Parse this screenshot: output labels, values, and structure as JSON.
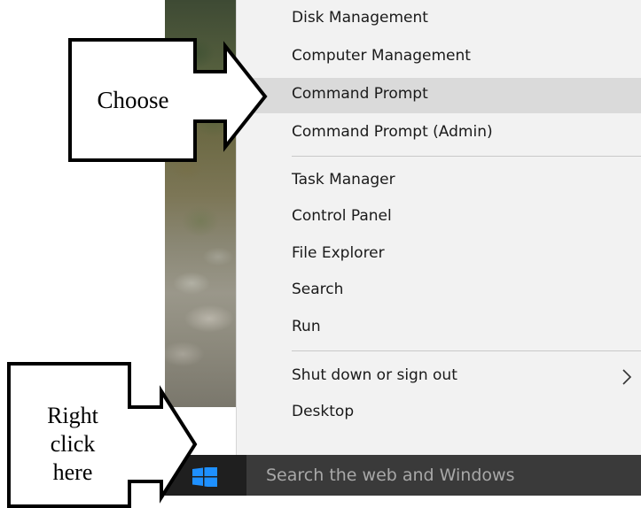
{
  "context_menu": {
    "items": [
      {
        "label": "Disk Management"
      },
      {
        "label": "Computer Management"
      },
      {
        "label": "Command Prompt"
      },
      {
        "label": "Command Prompt (Admin)"
      },
      {
        "label": "Task Manager"
      },
      {
        "label": "Control Panel"
      },
      {
        "label": "File Explorer"
      },
      {
        "label": "Search"
      },
      {
        "label": "Run"
      },
      {
        "label": "Shut down or sign out"
      },
      {
        "label": "Desktop"
      }
    ],
    "highlighted": "Command Prompt",
    "submenu_icon": "chevron-right-icon"
  },
  "taskbar": {
    "start_icon": "windows-logo-icon",
    "search_placeholder": "Search the web and Windows"
  },
  "callouts": {
    "choose": "Choose",
    "right_click_line1": "Right",
    "right_click_line2": "click",
    "right_click_line3": "here"
  },
  "colors": {
    "menu_background": "#f2f2f2",
    "menu_highlight": "#dadada",
    "taskbar": "#1b1b1b",
    "search_box": "#3a3a3a",
    "windows_logo": "#1e90ff"
  }
}
